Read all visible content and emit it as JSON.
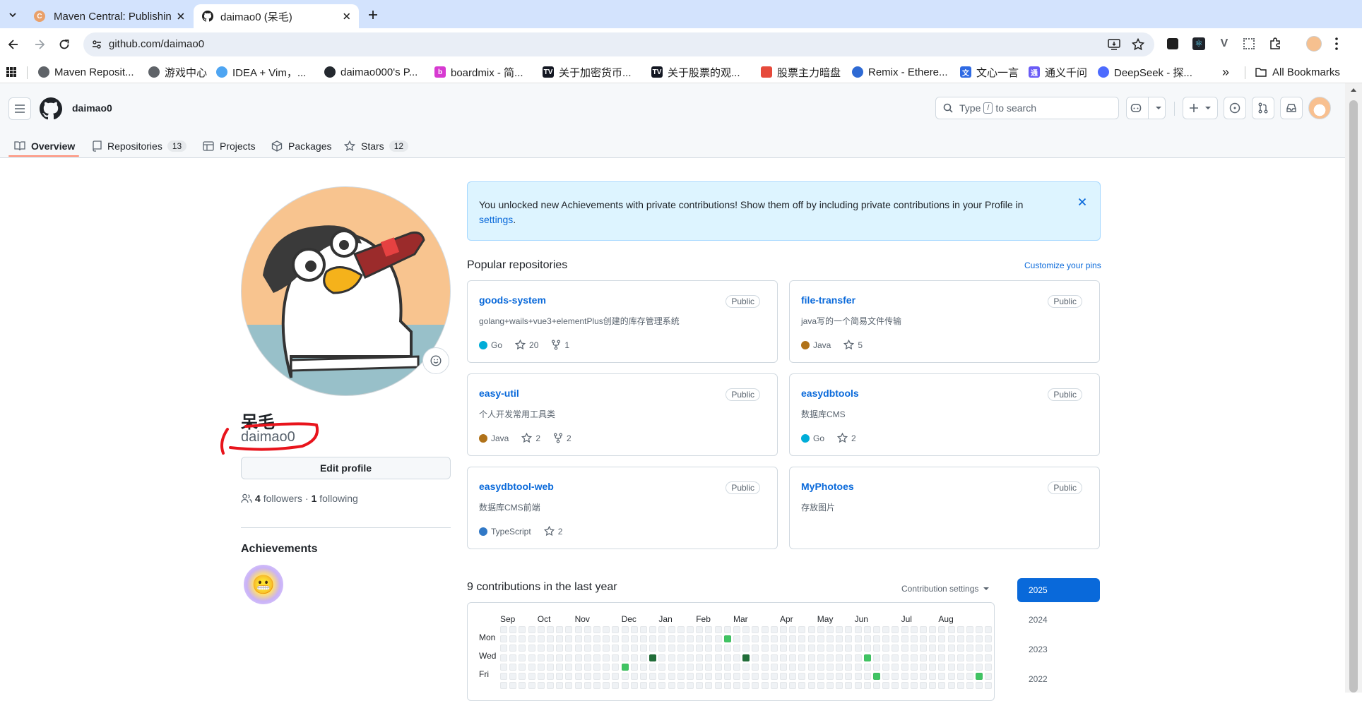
{
  "browser": {
    "tabs": [
      {
        "title": "Maven Central: Publishin",
        "favicon": "maven-icon"
      },
      {
        "title": "daimao0 (呆毛)",
        "favicon": "github-icon"
      }
    ],
    "url": "github.com/daimao0",
    "bookmarks": [
      "Maven Reposit...",
      "游戏中心",
      "IDEA + Vim，...",
      "daimao000's P...",
      "boardmix - 简...",
      "关于加密货币...",
      "关于股票的观...",
      "股票主力暗盘",
      "Remix - Ethere...",
      "文心一言",
      "通义千问",
      "DeepSeek - 探..."
    ],
    "all_bookmarks": "All Bookmarks"
  },
  "gh": {
    "username": "daimao0",
    "search_placeholder_pre": "Type",
    "search_key": "/",
    "search_placeholder_post": "to search",
    "nav": {
      "overview": "Overview",
      "repositories": "Repositories",
      "repositories_count": "13",
      "projects": "Projects",
      "packages": "Packages",
      "stars": "Stars",
      "stars_count": "12"
    }
  },
  "profile": {
    "display_name": "呆毛",
    "login": "daimao0",
    "edit_button": "Edit profile",
    "followers_count": "4",
    "followers_label": "followers",
    "separator": "·",
    "following_count": "1",
    "following_label": "following",
    "achievements_title": "Achievements"
  },
  "banner": {
    "text": "You unlocked new Achievements with private contributions! Show them off by including private contributions in your Profile in",
    "link": "settings",
    "end": "."
  },
  "popular": {
    "title": "Popular repositories",
    "customize": "Customize your pins",
    "repos": [
      {
        "name": "goods-system",
        "visibility": "Public",
        "desc": "golang+wails+vue3+elementPlus创建的库存管理系统",
        "lang": "Go",
        "lang_color": "#00add8",
        "stars": "20",
        "forks": "1"
      },
      {
        "name": "file-transfer",
        "visibility": "Public",
        "desc": "java写的一个简易文件传输",
        "lang": "Java",
        "lang_color": "#b07219",
        "stars": "5",
        "forks": ""
      },
      {
        "name": "easy-util",
        "visibility": "Public",
        "desc": "个人开发常用工具类",
        "lang": "Java",
        "lang_color": "#b07219",
        "stars": "2",
        "forks": "2"
      },
      {
        "name": "easydbtools",
        "visibility": "Public",
        "desc": "数据库CMS",
        "lang": "Go",
        "lang_color": "#00add8",
        "stars": "2",
        "forks": ""
      },
      {
        "name": "easydbtool-web",
        "visibility": "Public",
        "desc": "数据库CMS前端",
        "lang": "TypeScript",
        "lang_color": "#3178c6",
        "stars": "2",
        "forks": ""
      },
      {
        "name": "MyPhotoes",
        "visibility": "Public",
        "desc": "存放图片",
        "lang": "",
        "lang_color": "",
        "stars": "",
        "forks": ""
      }
    ]
  },
  "contrib": {
    "title": "9 contributions in the last year",
    "settings": "Contribution settings",
    "months": [
      "Sep",
      "Oct",
      "Nov",
      "Dec",
      "Jan",
      "Feb",
      "Mar",
      "Apr",
      "May",
      "Jun",
      "Jul",
      "Aug"
    ],
    "days": [
      "Mon",
      "Wed",
      "Fri"
    ],
    "years": [
      "2025",
      "2024",
      "2023",
      "2022"
    ],
    "active_cells": [
      {
        "week": 13,
        "day": 4,
        "level": 2
      },
      {
        "week": 16,
        "day": 3,
        "level": 4
      },
      {
        "week": 24,
        "day": 1,
        "level": 2
      },
      {
        "week": 26,
        "day": 3,
        "level": 4
      },
      {
        "week": 39,
        "day": 3,
        "level": 2
      },
      {
        "week": 40,
        "day": 5,
        "level": 2
      },
      {
        "week": 51,
        "day": 5,
        "level": 2
      }
    ],
    "level_colors": {
      "0": "#eff2f5",
      "2": "#40c463",
      "4": "#216e39"
    }
  }
}
